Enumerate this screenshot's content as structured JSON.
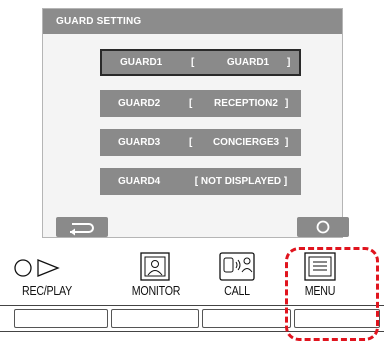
{
  "screen": {
    "title": "GUARD SETTING",
    "guards": [
      {
        "name": "GUARD1",
        "value": "GUARD1",
        "selected": true
      },
      {
        "name": "GUARD2",
        "value": "RECEPTION2",
        "selected": false
      },
      {
        "name": "GUARD3",
        "value": "CONCIERGE3",
        "selected": false
      },
      {
        "name": "GUARD4",
        "value": "[ NOT DISPLAYED ]",
        "selected": false
      }
    ],
    "bracket_left": "[",
    "bracket_right": "]",
    "back_icon": "return-arrow-icon",
    "ok_icon": "circle-icon"
  },
  "hardware": {
    "rec_play_label": "REC/PLAY",
    "monitor_label": "MONITOR",
    "call_label": "CALL",
    "menu_label": "MENU"
  },
  "colors": {
    "header": "#8c8c8c",
    "row": "#8a8a8a",
    "highlight": "#e0141e"
  }
}
